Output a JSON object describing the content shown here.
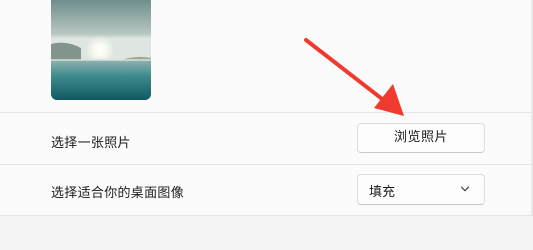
{
  "wallpaper": {
    "preview_icon": "lake-sunrise-wallpaper-thumbnail"
  },
  "choose_photo": {
    "label": "选择一张照片",
    "browse_button_label": "浏览照片"
  },
  "fit": {
    "label": "选择适合你的桌面图像",
    "selected_option": "填充",
    "dropdown_icon": "chevron-down-icon"
  },
  "annotation": {
    "arrow_color": "#f03a2e"
  }
}
